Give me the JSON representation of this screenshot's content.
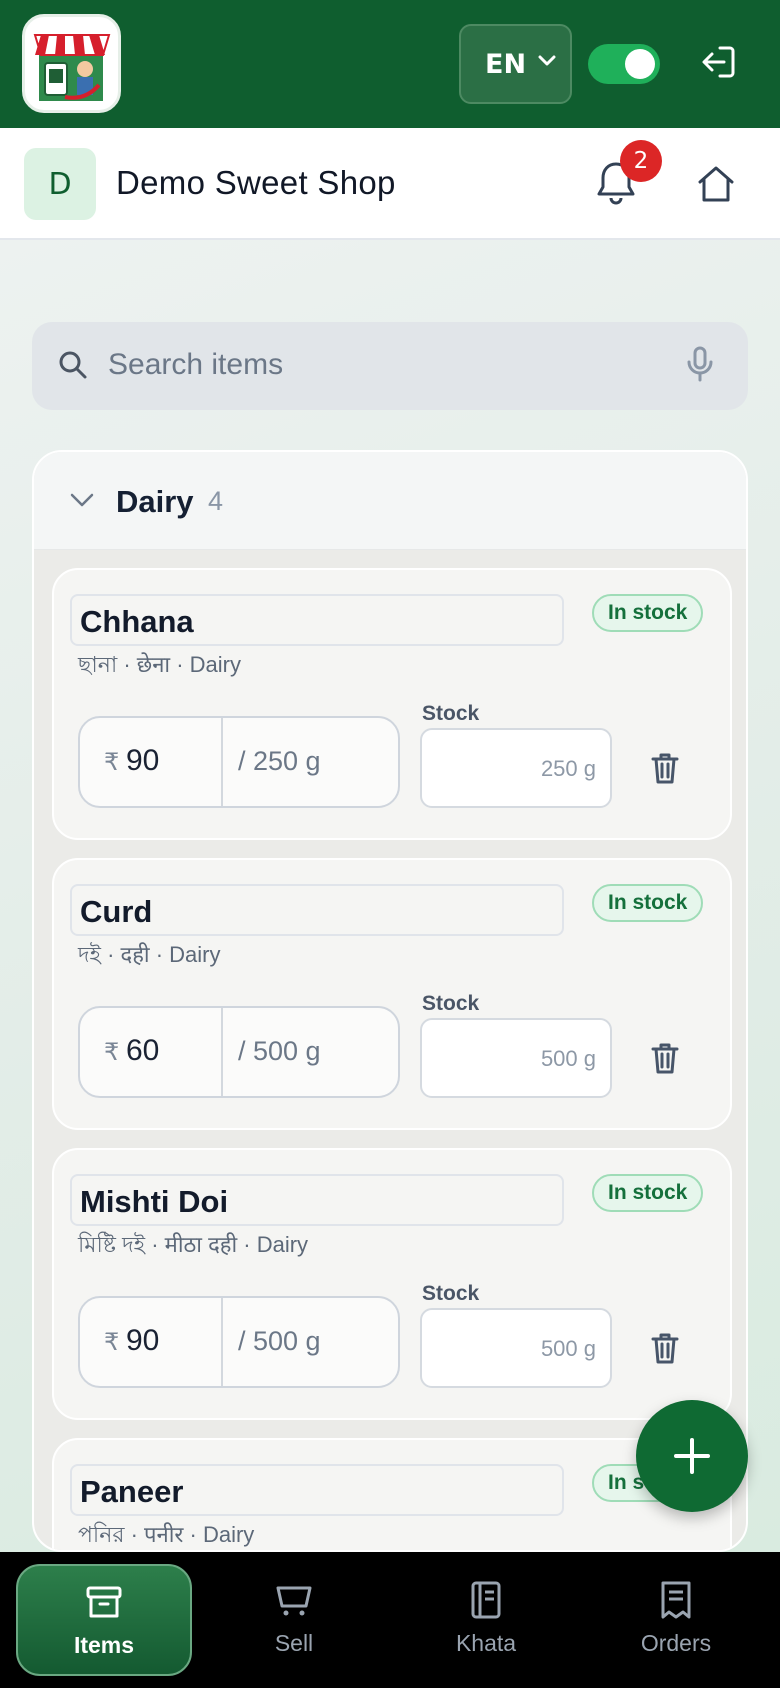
{
  "app": {
    "brand_colors": {
      "primary": "#0f5e2f",
      "accent": "#1fb05a",
      "badge": "#dc2626"
    }
  },
  "topbar": {
    "language": "EN",
    "toggle_on": true,
    "icons": [
      "shop-logo",
      "chevron-down-icon",
      "logout-icon"
    ]
  },
  "shop": {
    "avatar_letter": "D",
    "name": "Demo Sweet Shop",
    "notification_count": "2"
  },
  "search": {
    "placeholder": "Search items"
  },
  "group": {
    "title": "Dairy",
    "count": "4",
    "items": [
      {
        "name": "Chhana",
        "alias": "ছানা · छेना · Dairy",
        "status": "In stock",
        "currency": "₹",
        "price": "90",
        "unit": "/ 250 g",
        "stock_label": "Stock",
        "stock_placeholder": "250 g"
      },
      {
        "name": "Curd",
        "alias": "দই · दही · Dairy",
        "status": "In stock",
        "currency": "₹",
        "price": "60",
        "unit": "/ 500 g",
        "stock_label": "Stock",
        "stock_placeholder": "500 g"
      },
      {
        "name": "Mishti Doi",
        "alias": "মিষ্টি দই · मीठा दही · Dairy",
        "status": "In stock",
        "currency": "₹",
        "price": "90",
        "unit": "/ 500 g",
        "stock_label": "Stock",
        "stock_placeholder": "500 g"
      },
      {
        "name": "Paneer",
        "alias": "পনির · पनीर · Dairy",
        "status": "In stock"
      }
    ]
  },
  "bottom_nav": [
    {
      "label": "Items",
      "icon": "box-icon",
      "active": true
    },
    {
      "label": "Sell",
      "icon": "cart-icon",
      "active": false
    },
    {
      "label": "Khata",
      "icon": "ledger-icon",
      "active": false
    },
    {
      "label": "Orders",
      "icon": "receipt-icon",
      "active": false
    }
  ]
}
